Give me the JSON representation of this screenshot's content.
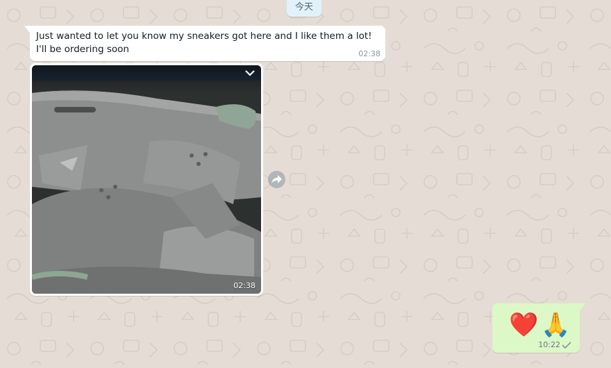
{
  "chat": {
    "date_divider": "今天",
    "incoming_text": {
      "text": "Just wanted to let you know my sneakers got here and I like them a lot! I'll be ordering soon",
      "time": "02:38"
    },
    "incoming_image": {
      "time": "02:38",
      "menu_icon": "chevron-down-icon",
      "forward_icon": "forward-icon"
    },
    "outgoing": {
      "emoji": "❤️🙏",
      "time": "10:22",
      "status_icon": "single-check-icon"
    }
  },
  "colors": {
    "wallpaper": "#e5ddd5",
    "incoming_bubble": "#ffffff",
    "outgoing_bubble": "#dcf8c6",
    "date_chip": "#e1f2fb",
    "meta_text": "#8696a0"
  }
}
